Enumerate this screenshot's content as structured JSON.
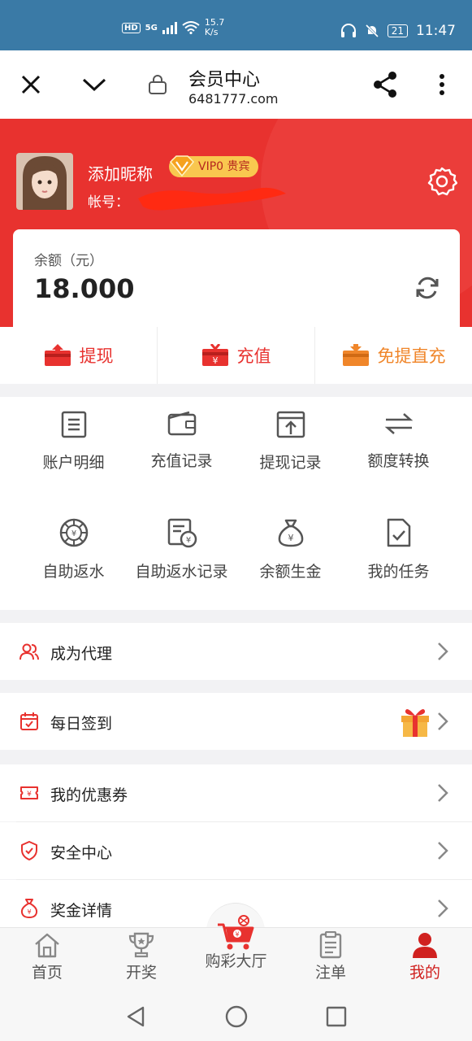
{
  "status_bar": {
    "hd": "HD",
    "network": "5G",
    "speed_value": "15.7",
    "speed_unit": "K/s",
    "battery": "21",
    "time": "11:47"
  },
  "browser": {
    "title": "会员中心",
    "url": "6481777.com"
  },
  "profile": {
    "nickname": "添加昵称",
    "vip_badge": "VIP0 贵宾",
    "account_label": "帐号："
  },
  "balance": {
    "label": "余额（元）",
    "value": "18.000"
  },
  "actions": [
    {
      "label": "提现"
    },
    {
      "label": "充值"
    },
    {
      "label": "免提直充"
    }
  ],
  "grid_items": [
    {
      "label": "账户明细",
      "icon": "account-detail-icon"
    },
    {
      "label": "充值记录",
      "icon": "wallet-icon"
    },
    {
      "label": "提现记录",
      "icon": "withdraw-record-icon"
    },
    {
      "label": "额度转换",
      "icon": "transfer-icon"
    },
    {
      "label": "自助返水",
      "icon": "rebate-icon"
    },
    {
      "label": "自助返水记录",
      "icon": "rebate-record-icon"
    },
    {
      "label": "余额生金",
      "icon": "money-bag-icon"
    },
    {
      "label": "我的任务",
      "icon": "task-icon"
    }
  ],
  "menu": {
    "agent": "成为代理",
    "checkin": "每日签到",
    "coupons": "我的优惠券",
    "security": "安全中心",
    "bonus": "奖金详情"
  },
  "tabs": [
    {
      "label": "首页"
    },
    {
      "label": "开奖"
    },
    {
      "label": "购彩大厅"
    },
    {
      "label": "注单"
    },
    {
      "label": "我的"
    }
  ],
  "colors": {
    "brand_red": "#e8322f",
    "active_tab": "#d0211f",
    "status_bar": "#3a7aa6",
    "vip_gold": "#f9c74f",
    "orange_accent": "#f0862a"
  }
}
